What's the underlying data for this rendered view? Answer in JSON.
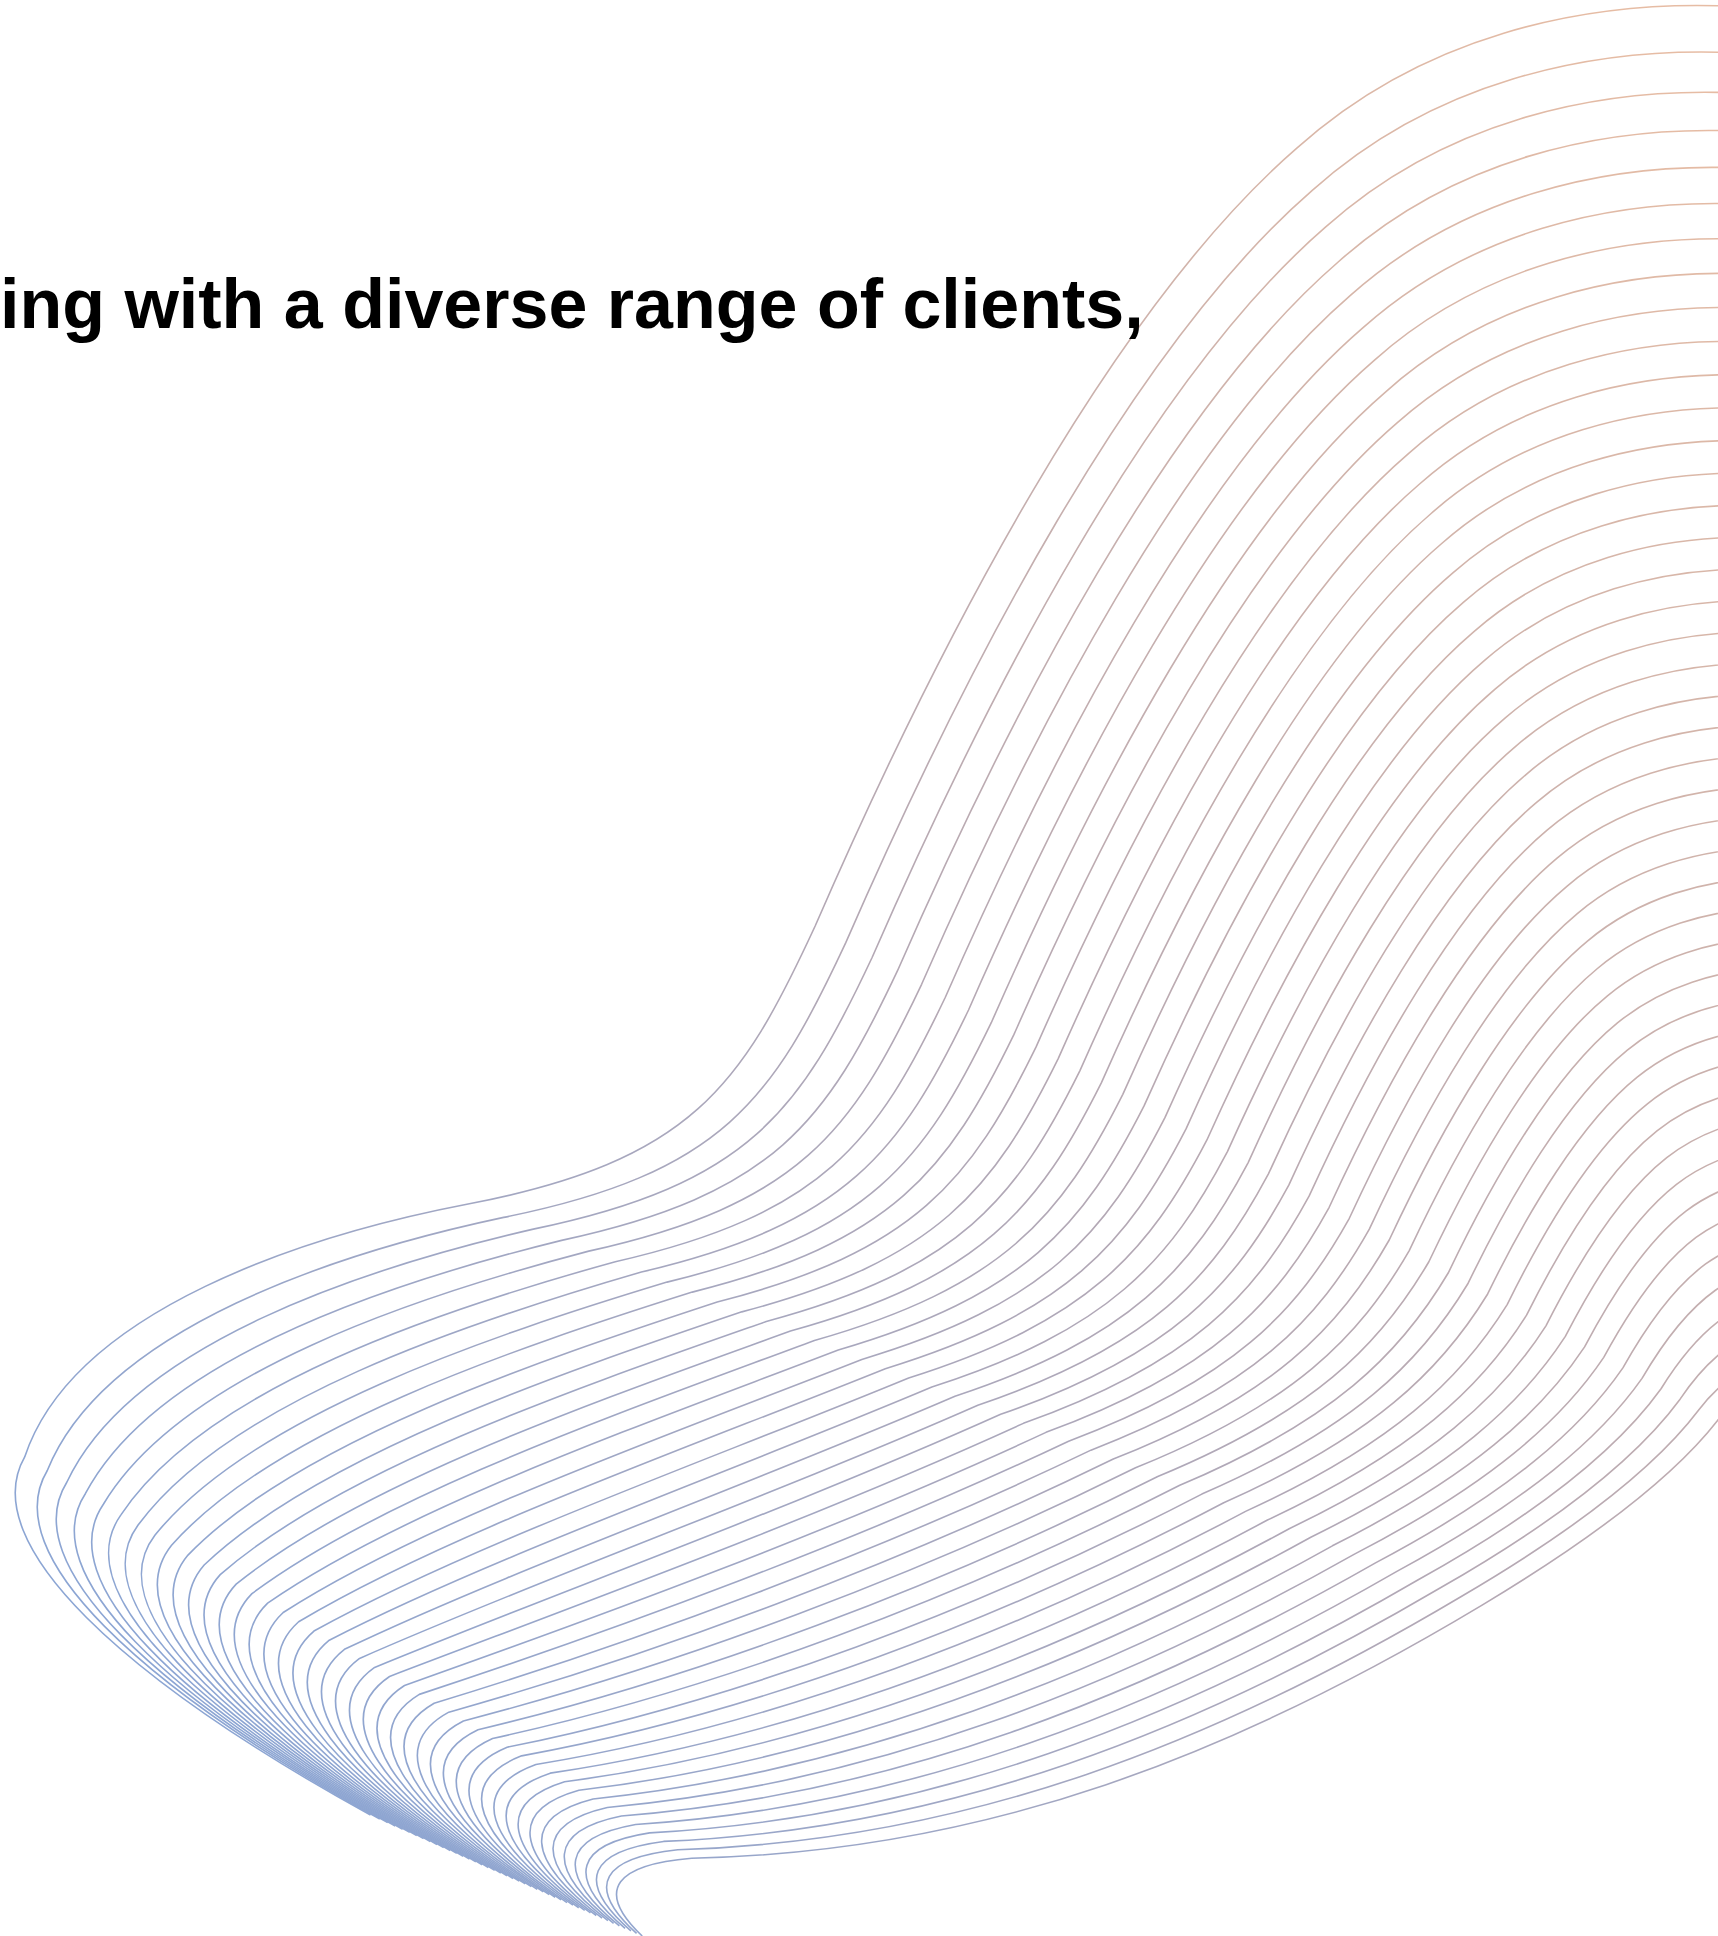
{
  "headline": {
    "text": "ing with a diverse range of clients,"
  }
}
